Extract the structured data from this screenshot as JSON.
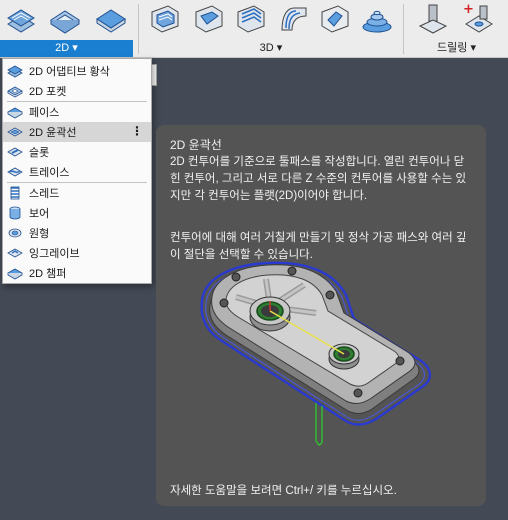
{
  "toolbar": {
    "groups": {
      "g2d": "2D ▾",
      "g3d": "3D ▾",
      "drill": "드릴링 ▾"
    },
    "icons": [
      "2d-adaptive-icon",
      "2d-pocket-icon",
      "face-icon",
      "adaptive-3d-icon",
      "pocket-3d-icon",
      "steep-shallow-icon",
      "flow-icon",
      "contour-3d-icon",
      "scallop-icon",
      "drill-icon",
      "hole-recognition-icon"
    ]
  },
  "menu": {
    "items": [
      {
        "label": "2D 어댑티브 황삭"
      },
      {
        "label": "2D 포켓"
      },
      {
        "label": "페이스"
      },
      {
        "label": "2D 윤곽선",
        "more": "⋮"
      },
      {
        "label": "슬롯"
      },
      {
        "label": "트레이스"
      },
      {
        "label": "스레드"
      },
      {
        "label": "보어"
      },
      {
        "label": "원형"
      },
      {
        "label": "잉그레이브"
      },
      {
        "label": "2D 챔퍼"
      }
    ]
  },
  "tooltip": {
    "title": "2D 윤곽선",
    "paragraph1": "2D 컨투어를 기준으로 툴패스를 작성합니다. 열린 컨투어나 닫힌 컨투어, 그리고 서로 다른 Z 수준의 컨투어를 사용할 수는 있지만 각 컨투어는 플랫(2D)이어야 합니다.",
    "paragraph2": "컨투어에 대해 여러 거칠게 만들기 및 정삭 가공 패스와 여러 깊이 절단을 선택할 수 있습니다.",
    "footer": "자세한 도움말을 보려면 Ctrl+/ 키를 누르십시오."
  },
  "colors": {
    "accent": "#1b7fd1",
    "canvas": "#434955",
    "tooltip_bg": "#545454",
    "toolpath": "#2a3ad0"
  }
}
